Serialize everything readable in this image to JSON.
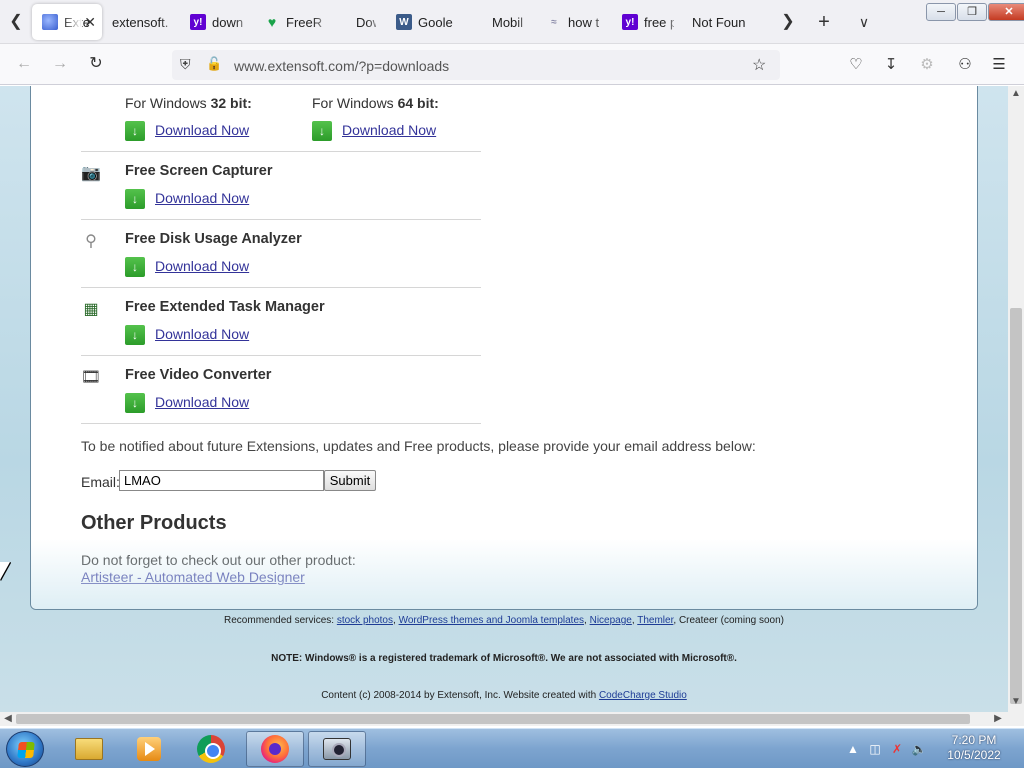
{
  "browser": {
    "tabs": [
      {
        "label": "Exte",
        "icon": "globe-icon",
        "active": true
      },
      {
        "label": "extensoft.",
        "icon": "",
        "active": false
      },
      {
        "label": "down",
        "icon": "yahoo-icon",
        "active": false
      },
      {
        "label": "FreeR",
        "icon": "free-icon",
        "active": false
      },
      {
        "label": "Down",
        "icon": "",
        "active": false
      },
      {
        "label": "Goole",
        "icon": "wordpress-icon",
        "active": false
      },
      {
        "label": "Mobil",
        "icon": "",
        "active": false
      },
      {
        "label": "how t",
        "icon": "how-icon",
        "active": false
      },
      {
        "label": "free p",
        "icon": "yahoo-icon",
        "active": false
      },
      {
        "label": "Not Foun",
        "icon": "",
        "active": false
      }
    ],
    "url": "www.extensoft.com/?p=downloads"
  },
  "page": {
    "win32_prefix": "For Windows",
    "win32_bits": "32 bit:",
    "win64_prefix": "For Windows",
    "win64_bits": "64 bit:",
    "download_label": "Download Now",
    "products": [
      {
        "title": "Free Screen Capturer",
        "icon": "camera-icon"
      },
      {
        "title": "Free Disk Usage Analyzer",
        "icon": "disk-icon"
      },
      {
        "title": "Free Extended Task Manager",
        "icon": "task-manager-icon"
      },
      {
        "title": "Free Video Converter",
        "icon": "video-icon"
      }
    ],
    "notify_text": "To be notified about future Extensions, updates and Free products, please provide your email address below:",
    "email_label": "Email:",
    "email_value": "LMAO",
    "submit_label": "Submit",
    "other_heading": "Other Products",
    "other_text": "Do not forget to check out our other product:",
    "other_link": "Artisteer - Automated Web Designer"
  },
  "footer": {
    "recommended_prefix": "Recommended services:",
    "links": [
      "stock photos",
      "WordPress themes and Joomla templates",
      "Nicepage",
      "Themler"
    ],
    "recommended_suffix": "Createer (coming soon)",
    "note": "NOTE: Windows® is a registered trademark of Microsoft®. We are not associated with Microsoft®.",
    "content_prefix": "Content (c) 2008-2014 by Extensoft, Inc. Website created with",
    "content_link": "CodeCharge Studio"
  },
  "taskbar": {
    "time": "7:20 PM",
    "date": "10/5/2022"
  },
  "colors": {
    "link": "#333399",
    "download_green": "#2c9c2a",
    "page_bg": "#c9dfe8"
  }
}
